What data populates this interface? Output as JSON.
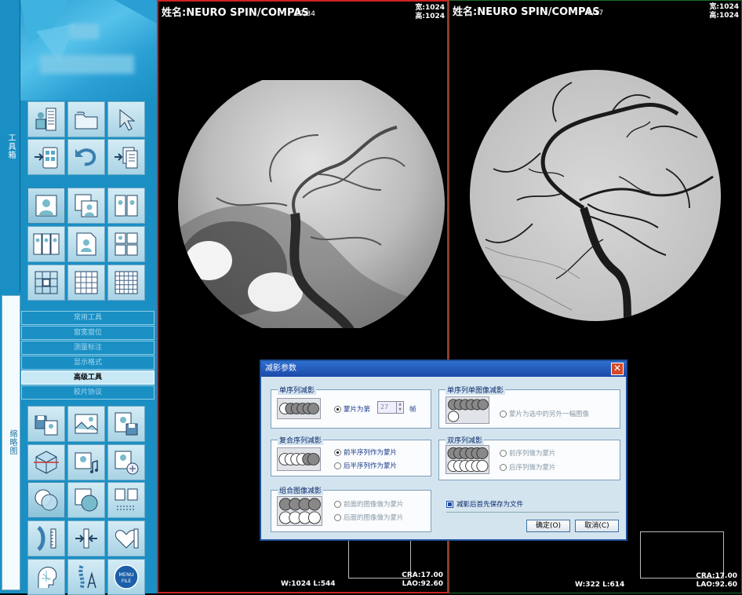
{
  "sidebar": {
    "tab_tools": "工具箱",
    "tab_thumbs": "缩略图",
    "menu": [
      {
        "label": "常用工具",
        "active": false
      },
      {
        "label": "窗宽窗位",
        "active": false
      },
      {
        "label": "测量标注",
        "active": false
      },
      {
        "label": "显示格式",
        "active": false
      },
      {
        "label": "高级工具",
        "active": true
      },
      {
        "label": "胶片协议",
        "active": false
      }
    ],
    "menu_file_label": "MENU",
    "menu_file_sub": "FILE"
  },
  "viewports": [
    {
      "name": "姓名:NEURO SPIN/COMPAS",
      "index": "27/34",
      "width": "宽:1024",
      "height": "高:1024",
      "wl": "W:1024 L:544",
      "cra": "CRA:17.00",
      "lao": "LAO:92.60"
    },
    {
      "name": "姓名:NEURO SPIN/COMPAS",
      "index": "8/17",
      "width": "宽:1024",
      "height": "高:1024",
      "wl": "W:322 L:614",
      "cra": "CRA:17.00",
      "lao": "LAO:92.60"
    }
  ],
  "dialog": {
    "title": "减影参数",
    "close": "✕",
    "g1": {
      "title": "单序列减影",
      "opt": "蒙片为第",
      "value": "27",
      "unit": "帧"
    },
    "g2": {
      "title": "单序列单图像减影",
      "opt": "蒙片为选中的另外一幅图像"
    },
    "g3": {
      "title": "复合序列减影",
      "opt1": "前半序列作为蒙片",
      "opt2": "后半序列作为蒙片"
    },
    "g4": {
      "title": "双序列减影",
      "opt1": "前序列做为蒙片",
      "opt2": "后序列做为蒙片"
    },
    "g5": {
      "title": "组合图像减影",
      "opt1": "前面的图像做为蒙片",
      "opt2": "后面的图像做为蒙片"
    },
    "save_check": "减影后首先保存为文件",
    "ok": "确定(O)",
    "cancel": "取消(C)"
  },
  "colors": {
    "sidebar": "#1a8fc4",
    "dialog_title": "#1c4aa8",
    "active_border": "#cc2222"
  }
}
